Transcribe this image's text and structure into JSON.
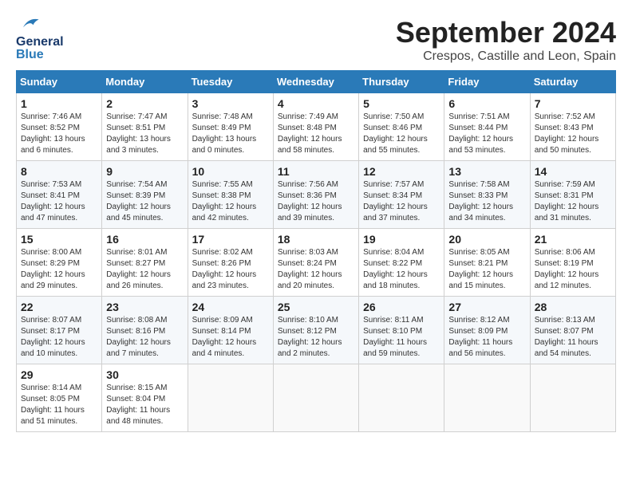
{
  "logo": {
    "general": "General",
    "blue": "Blue"
  },
  "header": {
    "month": "September 2024",
    "location": "Crespos, Castille and Leon, Spain"
  },
  "weekdays": [
    "Sunday",
    "Monday",
    "Tuesday",
    "Wednesday",
    "Thursday",
    "Friday",
    "Saturday"
  ],
  "weeks": [
    [
      {
        "day": "1",
        "sunrise": "7:46 AM",
        "sunset": "8:52 PM",
        "daylight": "13 hours and 6 minutes."
      },
      {
        "day": "2",
        "sunrise": "7:47 AM",
        "sunset": "8:51 PM",
        "daylight": "13 hours and 3 minutes."
      },
      {
        "day": "3",
        "sunrise": "7:48 AM",
        "sunset": "8:49 PM",
        "daylight": "13 hours and 0 minutes."
      },
      {
        "day": "4",
        "sunrise": "7:49 AM",
        "sunset": "8:48 PM",
        "daylight": "12 hours and 58 minutes."
      },
      {
        "day": "5",
        "sunrise": "7:50 AM",
        "sunset": "8:46 PM",
        "daylight": "12 hours and 55 minutes."
      },
      {
        "day": "6",
        "sunrise": "7:51 AM",
        "sunset": "8:44 PM",
        "daylight": "12 hours and 53 minutes."
      },
      {
        "day": "7",
        "sunrise": "7:52 AM",
        "sunset": "8:43 PM",
        "daylight": "12 hours and 50 minutes."
      }
    ],
    [
      {
        "day": "8",
        "sunrise": "7:53 AM",
        "sunset": "8:41 PM",
        "daylight": "12 hours and 47 minutes."
      },
      {
        "day": "9",
        "sunrise": "7:54 AM",
        "sunset": "8:39 PM",
        "daylight": "12 hours and 45 minutes."
      },
      {
        "day": "10",
        "sunrise": "7:55 AM",
        "sunset": "8:38 PM",
        "daylight": "12 hours and 42 minutes."
      },
      {
        "day": "11",
        "sunrise": "7:56 AM",
        "sunset": "8:36 PM",
        "daylight": "12 hours and 39 minutes."
      },
      {
        "day": "12",
        "sunrise": "7:57 AM",
        "sunset": "8:34 PM",
        "daylight": "12 hours and 37 minutes."
      },
      {
        "day": "13",
        "sunrise": "7:58 AM",
        "sunset": "8:33 PM",
        "daylight": "12 hours and 34 minutes."
      },
      {
        "day": "14",
        "sunrise": "7:59 AM",
        "sunset": "8:31 PM",
        "daylight": "12 hours and 31 minutes."
      }
    ],
    [
      {
        "day": "15",
        "sunrise": "8:00 AM",
        "sunset": "8:29 PM",
        "daylight": "12 hours and 29 minutes."
      },
      {
        "day": "16",
        "sunrise": "8:01 AM",
        "sunset": "8:27 PM",
        "daylight": "12 hours and 26 minutes."
      },
      {
        "day": "17",
        "sunrise": "8:02 AM",
        "sunset": "8:26 PM",
        "daylight": "12 hours and 23 minutes."
      },
      {
        "day": "18",
        "sunrise": "8:03 AM",
        "sunset": "8:24 PM",
        "daylight": "12 hours and 20 minutes."
      },
      {
        "day": "19",
        "sunrise": "8:04 AM",
        "sunset": "8:22 PM",
        "daylight": "12 hours and 18 minutes."
      },
      {
        "day": "20",
        "sunrise": "8:05 AM",
        "sunset": "8:21 PM",
        "daylight": "12 hours and 15 minutes."
      },
      {
        "day": "21",
        "sunrise": "8:06 AM",
        "sunset": "8:19 PM",
        "daylight": "12 hours and 12 minutes."
      }
    ],
    [
      {
        "day": "22",
        "sunrise": "8:07 AM",
        "sunset": "8:17 PM",
        "daylight": "12 hours and 10 minutes."
      },
      {
        "day": "23",
        "sunrise": "8:08 AM",
        "sunset": "8:16 PM",
        "daylight": "12 hours and 7 minutes."
      },
      {
        "day": "24",
        "sunrise": "8:09 AM",
        "sunset": "8:14 PM",
        "daylight": "12 hours and 4 minutes."
      },
      {
        "day": "25",
        "sunrise": "8:10 AM",
        "sunset": "8:12 PM",
        "daylight": "12 hours and 2 minutes."
      },
      {
        "day": "26",
        "sunrise": "8:11 AM",
        "sunset": "8:10 PM",
        "daylight": "11 hours and 59 minutes."
      },
      {
        "day": "27",
        "sunrise": "8:12 AM",
        "sunset": "8:09 PM",
        "daylight": "11 hours and 56 minutes."
      },
      {
        "day": "28",
        "sunrise": "8:13 AM",
        "sunset": "8:07 PM",
        "daylight": "11 hours and 54 minutes."
      }
    ],
    [
      {
        "day": "29",
        "sunrise": "8:14 AM",
        "sunset": "8:05 PM",
        "daylight": "11 hours and 51 minutes."
      },
      {
        "day": "30",
        "sunrise": "8:15 AM",
        "sunset": "8:04 PM",
        "daylight": "11 hours and 48 minutes."
      },
      null,
      null,
      null,
      null,
      null
    ]
  ]
}
